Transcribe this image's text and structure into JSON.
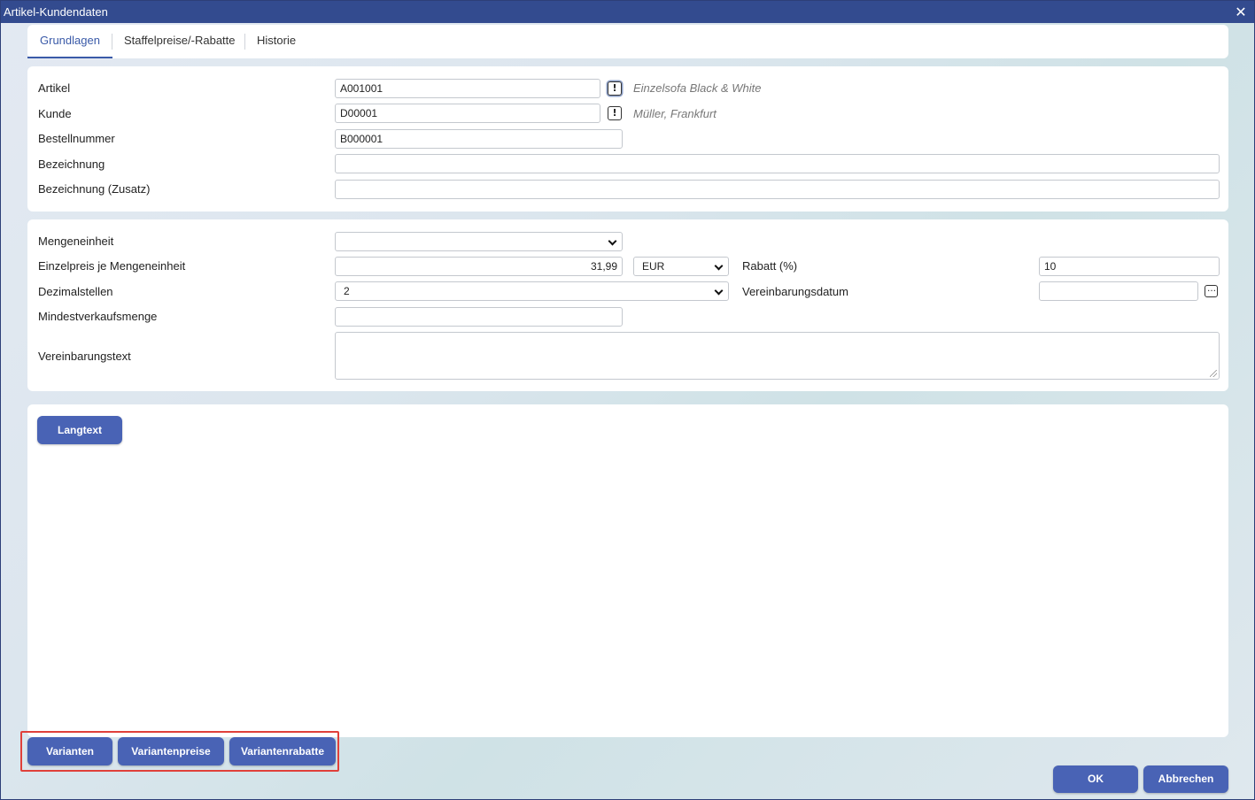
{
  "window": {
    "title": "Artikel-Kundendaten",
    "close_glyph": "✕"
  },
  "tabs": [
    {
      "label": "Grundlagen",
      "active": true
    },
    {
      "label": "Staffelpreise/-Rabatte",
      "active": false
    },
    {
      "label": "Historie",
      "active": false
    }
  ],
  "section1": {
    "artikel": {
      "label": "Artikel",
      "value": "A001001",
      "hint": "Einzelsofa Black & White",
      "icon": "exclamation-icon"
    },
    "kunde": {
      "label": "Kunde",
      "value": "D00001",
      "hint": "Müller, Frankfurt",
      "icon": "exclamation-icon"
    },
    "bestellnummer": {
      "label": "Bestellnummer",
      "value": "B000001"
    },
    "bezeichnung": {
      "label": "Bezeichnung",
      "value": ""
    },
    "bezeichnung_zusatz": {
      "label": "Bezeichnung (Zusatz)",
      "value": ""
    }
  },
  "section2": {
    "mengeneinheit": {
      "label": "Mengeneinheit",
      "value": ""
    },
    "einzelpreis": {
      "label": "Einzelpreis je Mengeneinheit",
      "value": "31,99",
      "currency": "EUR"
    },
    "rabatt": {
      "label": "Rabatt (%)",
      "value": "10"
    },
    "dezimalstellen": {
      "label": "Dezimalstellen",
      "value": "2"
    },
    "vereinbarungsdatum": {
      "label": "Vereinbarungsdatum",
      "value": "",
      "icon": "ellipsis-icon"
    },
    "mindestverkaufsmenge": {
      "label": "Mindestverkaufsmenge",
      "value": ""
    },
    "vereinbarungstext": {
      "label": "Vereinbarungstext",
      "value": ""
    }
  },
  "section3": {
    "langtext_button": "Langtext"
  },
  "footer": {
    "varianten": "Varianten",
    "variantenpreise": "Variantenpreise",
    "variantenrabatte": "Variantenrabatte",
    "ok": "OK",
    "abbrechen": "Abbrechen"
  },
  "colors": {
    "titlebar": "#334b8f",
    "accent": "#3a5aa8",
    "button": "#4963b5",
    "highlight": "#e0403a"
  }
}
